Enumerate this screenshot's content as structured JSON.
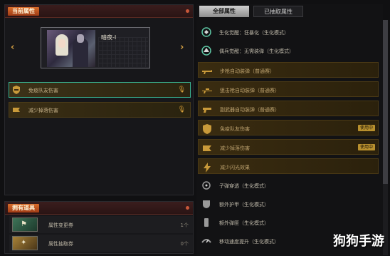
{
  "left": {
    "attr_title": "当前属性",
    "character_name": "暗夜-Ⅰ",
    "properties": [
      {
        "label": "免疫队友伤害",
        "selected": true
      },
      {
        "label": "减少掉落伤害",
        "selected": false
      }
    ]
  },
  "owned": {
    "title": "拥有道具",
    "items": [
      {
        "name": "属性变更券",
        "count": "1个",
        "icon": "exchange-icon"
      },
      {
        "name": "属性抽取券",
        "count": "0个",
        "icon": "draw-icon"
      }
    ]
  },
  "tabs": [
    {
      "label": "全部属性",
      "active": true
    },
    {
      "label": "已抽取属性",
      "active": false
    }
  ],
  "attributes": [
    {
      "label": "生化觉醒：狂暴化（生化模式）",
      "style": "plain",
      "icon": "awaken-icon"
    },
    {
      "label": "偶兵觉醒：无需装弹（生化模式）",
      "style": "plain",
      "icon": "awaken-icon"
    },
    {
      "label": "步枪自动装弹（普通赛）",
      "style": "gold",
      "icon": "rifle-icon"
    },
    {
      "label": "狙击枪自动装弹（普通赛）",
      "style": "gold",
      "icon": "sniper-icon"
    },
    {
      "label": "副武器自动装弹（普通赛）",
      "style": "gold",
      "icon": "pistol-icon"
    },
    {
      "label": "免疫队友伤害",
      "style": "gold",
      "icon": "shield-icon",
      "badge": "使用中"
    },
    {
      "label": "减少掉落伤害",
      "style": "gold",
      "icon": "fall-icon",
      "badge": "使用中"
    },
    {
      "label": "减少闪光效果",
      "style": "gold",
      "icon": "flash-icon"
    },
    {
      "label": "子弹穿透（生化模式）",
      "style": "plain",
      "icon": "bullet-icon"
    },
    {
      "label": "额外护甲（生化模式）",
      "style": "plain",
      "icon": "armor-icon"
    },
    {
      "label": "额外弹匣（生化模式）",
      "style": "plain",
      "icon": "magazine-icon"
    },
    {
      "label": "移动速度提升（生化模式）",
      "style": "plain",
      "icon": "speed-icon"
    }
  ],
  "watermark": "狗狗手游",
  "colors": {
    "accent_gold": "#d7a243",
    "selection_teal": "#39b391",
    "header_red": "#a03c16"
  }
}
